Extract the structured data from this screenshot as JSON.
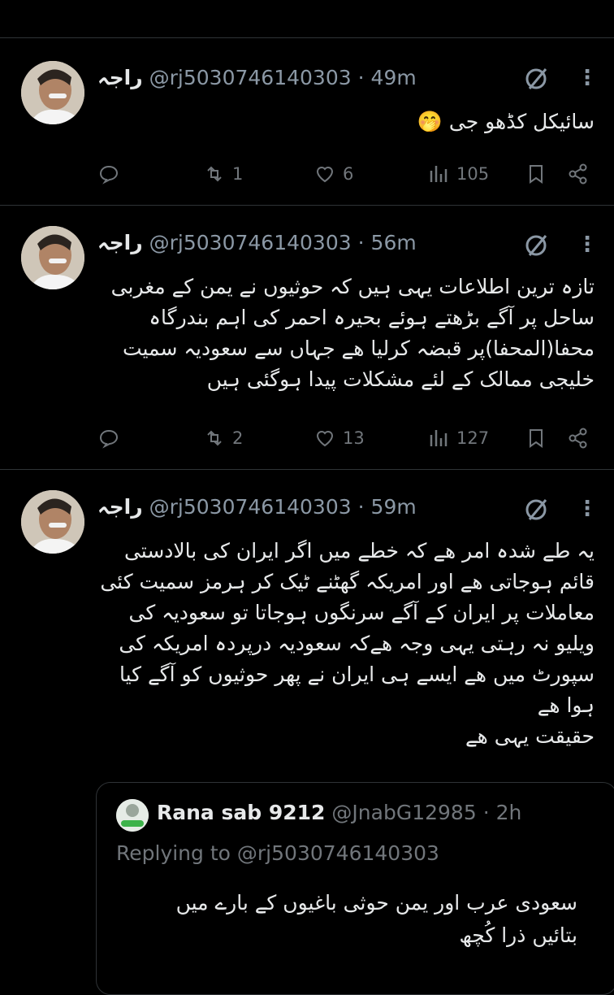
{
  "tweets": [
    {
      "name": "راجہ",
      "handle": "@rj5030746140303",
      "time": "· 49m",
      "lines": [
        "سائیکل کڈھو جی 🤭"
      ],
      "replies": "",
      "retweets": "1",
      "likes": "6",
      "views": "105"
    },
    {
      "name": "راجہ",
      "handle": "@rj5030746140303",
      "time": "· 56m",
      "lines": [
        "تازہ ترین اطلاعات یہی ہیں کہ حوثیوں نے یمن کے مغربی",
        "ساحل پر آگے بڑھتے ہوئے بحیرہ احمر کی اہم بندرگاہ",
        "محفا(المحفا)پر قبضہ کرلیا ھے جہاں سے سعودیہ سمیت",
        "خلیجی ممالک کے لئے مشکلات پیدا ہوگئی ہیں"
      ],
      "replies": "",
      "retweets": "2",
      "likes": "13",
      "views": "127"
    },
    {
      "name": "راجہ",
      "handle": "@rj5030746140303",
      "time": "· 59m",
      "lines": [
        "یہ طے شدہ امر ھے کہ خطے میں اگر ایران کی بالادستی",
        "قائم ہوجاتی ھے اور امریکہ گھٹنے ٹیک کر ہرمز سمیت کئی",
        "معاملات پر ایران کے آگے سرنگوں ہوجاتا تو سعودیہ کی",
        "ویلیو نہ رہتی یہی وجہ ھےکہ سعودیہ درپردہ امریکہ کی",
        "سپورٹ میں ھے ایسے ہی ایران نے پھر حوثیوں کو آگے کیا",
        "ہوا ھے",
        "حقیقت یہی ھے"
      ]
    }
  ],
  "quote": {
    "name": "Rana sab 9212",
    "handle": "@JnabG12985",
    "time": "· 2h",
    "replying_prefix": "Replying to",
    "replying_handle": "@rj5030746140303",
    "lines": [
      "سعودی عرب اور یمن حوثی باغیوں کے بارے میں",
      "بتائیں ذرا کُچھ"
    ]
  },
  "colors": {
    "background": "#000000",
    "divider": "#2f3336",
    "text": "#e7e9ea",
    "muted": "#71767b"
  }
}
